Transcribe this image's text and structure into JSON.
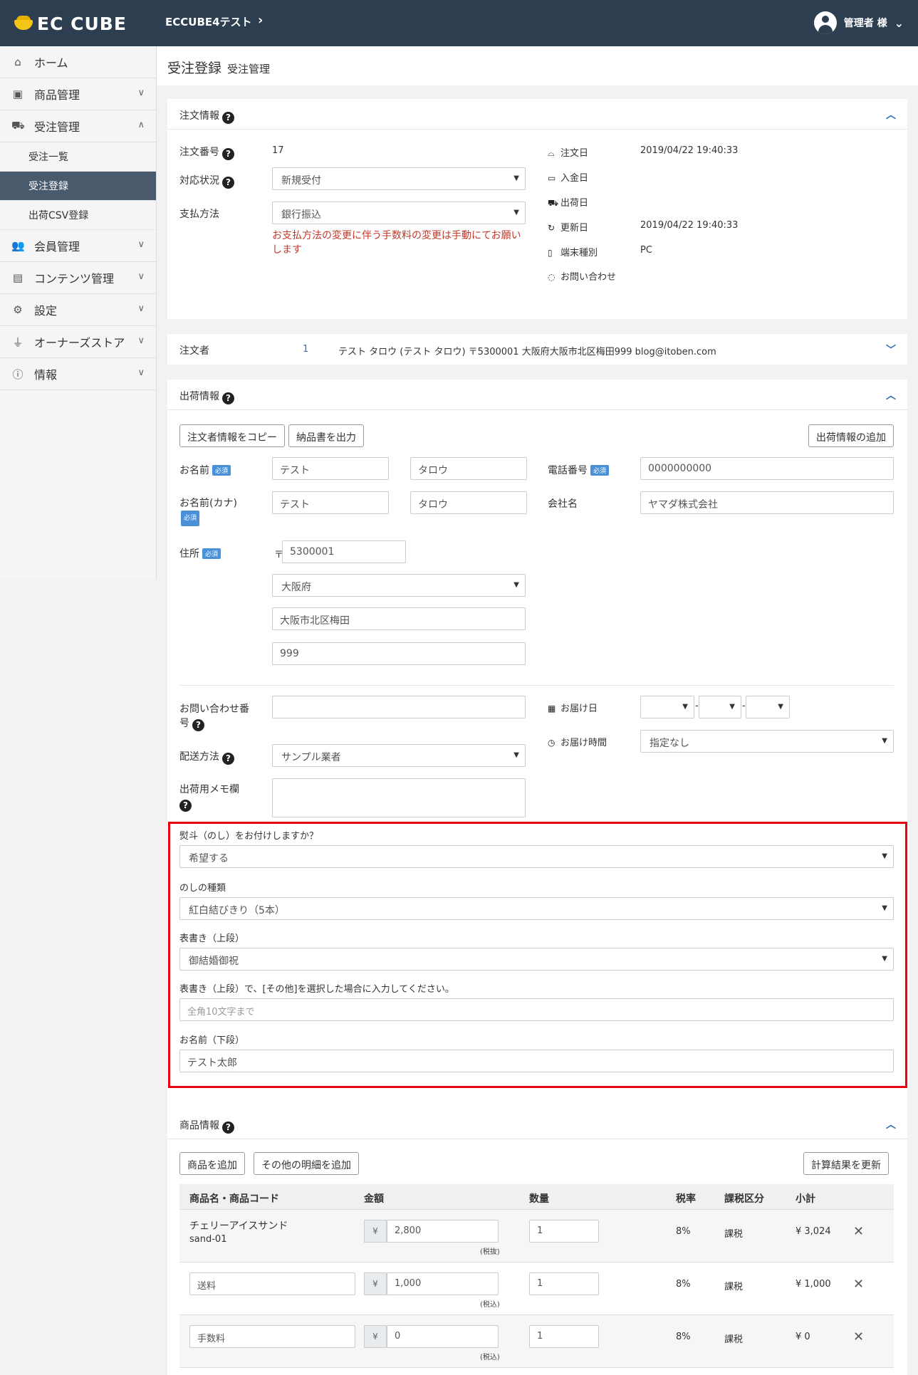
{
  "header": {
    "logo": "EC CUBE",
    "shop_name": "ECCUBE4テスト",
    "user_name": "管理者 様"
  },
  "sidebar": {
    "items": [
      {
        "label": "ホーム",
        "icon": "home-icon"
      },
      {
        "label": "商品管理",
        "icon": "box-icon"
      },
      {
        "label": "受注管理",
        "icon": "cart-icon"
      },
      {
        "label": "会員管理",
        "icon": "users-icon"
      },
      {
        "label": "コンテンツ管理",
        "icon": "file-icon"
      },
      {
        "label": "設定",
        "icon": "gear-icon"
      },
      {
        "label": "オーナーズストア",
        "icon": "plug-icon"
      },
      {
        "label": "情報",
        "icon": "info-icon"
      }
    ],
    "sub_items": [
      {
        "label": "受注一覧"
      },
      {
        "label": "受注登録",
        "active": true
      },
      {
        "label": "出荷CSV登録"
      }
    ]
  },
  "page": {
    "title": "受注登録",
    "subtitle": "受注管理"
  },
  "order_info": {
    "title": "注文情報",
    "order_no_label": "注文番号",
    "order_no": "17",
    "status_label": "対応状況",
    "status_value": "新規受付",
    "payment_label": "支払方法",
    "payment_value": "銀行振込",
    "payment_error": "お支払方法の変更に伴う手数料の変更は手動にてお願いします",
    "order_date_label": "注文日",
    "order_date": "2019/04/22 19:40:33",
    "payment_date_label": "入金日",
    "ship_date_label": "出荷日",
    "update_date_label": "更新日",
    "update_date": "2019/04/22 19:40:33",
    "device_label": "端末種別",
    "device": "PC",
    "inquiry_label": "お問い合わせ"
  },
  "customer": {
    "label": "注文者",
    "id": "1",
    "summary": "テスト タロウ (テスト タロウ) 〒5300001 大阪府大阪市北区梅田999 blog@itoben.com"
  },
  "shipping": {
    "title": "出荷情報",
    "copy_button": "注文者情報をコピー",
    "delivery_note_button": "納品書を出力",
    "add_shipping_button": "出荷情報の追加",
    "required_badge": "必須",
    "name_label": "お名前",
    "last_name": "テスト",
    "first_name": "タロウ",
    "kana_label": "お名前(カナ)",
    "last_kana": "テスト",
    "first_kana": "タロウ",
    "address_label": "住所",
    "postal_mark": "〒",
    "postal_code": "5300001",
    "prefecture": "大阪府",
    "city": "大阪市北区梅田",
    "address2": "999",
    "phone_label": "電話番号",
    "phone": "0000000000",
    "company_label": "会社名",
    "company": "ヤマダ株式会社",
    "tracking_label_1": "お問い合わせ番",
    "tracking_label_2": "号",
    "delivery_method_label": "配送方法",
    "delivery_method": "サンプル業者",
    "memo_label": "出荷用メモ欄",
    "delivery_date_label": "お届け日",
    "date_sep": "-",
    "delivery_time_label": "お届け時間",
    "delivery_time": "指定なし"
  },
  "noshi": {
    "question": "熨斗（のし）をお付けしますか？",
    "want_value": "希望する",
    "type_label": "のしの種類",
    "type_value": "紅白結びきり（5本）",
    "upper_label": "表書き（上段）",
    "upper_value": "御結婚御祝",
    "other_label": "表書き（上段）で、[その他]を選択した場合に入力してください。",
    "other_placeholder": "全角10文字まで",
    "lower_label": "お名前（下段）",
    "lower_value": "テスト太郎"
  },
  "products": {
    "title": "商品情報",
    "add_product_button": "商品を追加",
    "add_other_button": "その他の明細を追加",
    "recalc_button": "計算結果を更新",
    "columns": [
      "商品名・商品コード",
      "金額",
      "数量",
      "税率",
      "課税区分",
      "小計"
    ],
    "yen": "¥",
    "rows": [
      {
        "name": "チェリーアイスサンド",
        "code": "sand-01",
        "price": "2,800",
        "tax_note": "(税抜)",
        "qty": "1",
        "rate": "8%",
        "tax_type": "課税",
        "subtotal": "¥ 3,024"
      },
      {
        "name": "送料",
        "price": "1,000",
        "tax_note": "(税込)",
        "qty": "1",
        "rate": "8%",
        "tax_type": "課税",
        "subtotal": "¥ 1,000"
      },
      {
        "name": "手数料",
        "price": "0",
        "tax_note": "(税込)",
        "qty": "1",
        "rate": "8%",
        "tax_type": "課税",
        "subtotal": "¥ 0"
      }
    ]
  },
  "colors": {
    "topbar": "#2c3e50",
    "sidebar_active": "#495a6d",
    "link": "#2c6fb7",
    "error": "#c0392b",
    "highlight_box": "#e60012",
    "required_badge": "#4a90d9"
  }
}
